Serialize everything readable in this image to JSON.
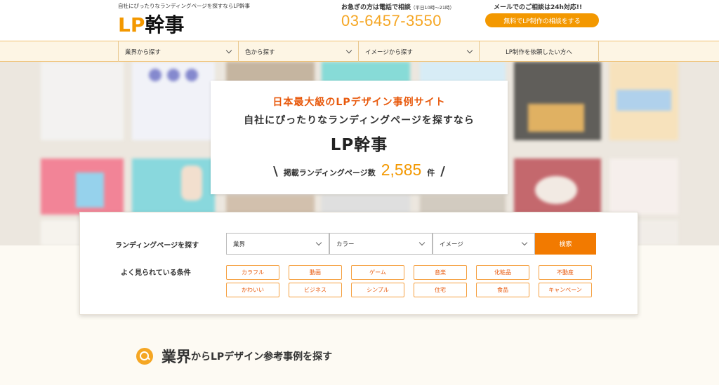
{
  "header": {
    "tagline": "自社にぴったりなランディングページを探すならLP幹事",
    "logo_accent": "LP",
    "logo_rest": "幹事",
    "phone_note": "お急ぎの方は電話で相談",
    "phone_hours": "（平日10時〜21時）",
    "phone_number": "03-6457-3550",
    "mail_note": "メールでのご相談は24h対応!!",
    "consult_button": "無料でLP制作の相談をする"
  },
  "nav": {
    "items": [
      {
        "label": "業界から探す"
      },
      {
        "label": "色から探す"
      },
      {
        "label": "イメージから探す"
      },
      {
        "label": "LP制作を依頼したい方へ"
      }
    ]
  },
  "hero": {
    "kicker": "日本最大級のLPデザイン事例サイト",
    "subtitle": "自社にぴったりなランディングページを探すなら",
    "title": "LP幹事",
    "count_label": "掲載ランディングページ数",
    "count_value": "2,585",
    "count_unit": "件",
    "slash_left": "\\",
    "slash_right": "/"
  },
  "search": {
    "label": "ランディングページを探す",
    "selects": [
      {
        "value": "業界"
      },
      {
        "value": "カラー"
      },
      {
        "value": "イメージ"
      }
    ],
    "button": "検索",
    "conditions_label": "よく見られている条件",
    "tags": [
      "カラフル",
      "動画",
      "ゲーム",
      "音楽",
      "化粧品",
      "不動産",
      "かわいい",
      "ビジネス",
      "シンプル",
      "住宅",
      "食品",
      "キャンペーン"
    ]
  },
  "section": {
    "title_em": "業界",
    "title_rest": "からLPデザイン参考事例を探す"
  },
  "colors": {
    "accent": "#f39800",
    "button": "#f27a00",
    "tag_text": "#e8590c"
  }
}
